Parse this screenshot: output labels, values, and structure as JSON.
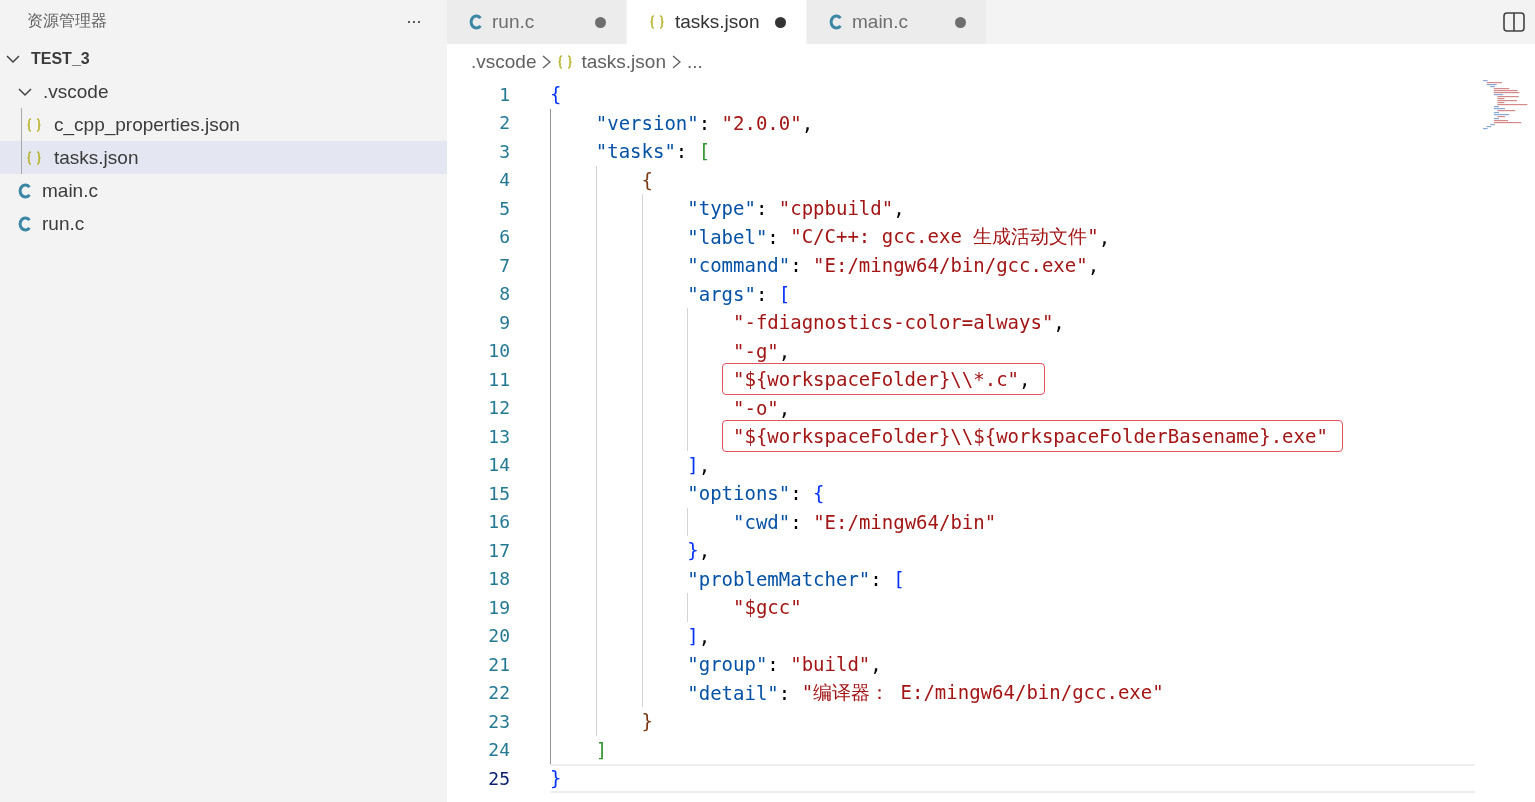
{
  "sidebar": {
    "title": "资源管理器",
    "more": "···",
    "tree": [
      {
        "label": "TEST_3",
        "kind": "root",
        "expanded": true,
        "selected": false,
        "children": [
          {
            "label": ".vscode",
            "kind": "folder",
            "expanded": true,
            "selected": false,
            "children": [
              {
                "label": "c_cpp_properties.json",
                "kind": "json",
                "selected": false
              },
              {
                "label": "tasks.json",
                "kind": "json",
                "selected": true
              }
            ]
          },
          {
            "label": "main.c",
            "kind": "c",
            "selected": false
          },
          {
            "label": "run.c",
            "kind": "c",
            "selected": false
          }
        ]
      }
    ]
  },
  "tabs": [
    {
      "label": "run.c",
      "kind": "c",
      "selected": false,
      "modified": true
    },
    {
      "label": "tasks.json",
      "kind": "json",
      "selected": true,
      "modified": true
    },
    {
      "label": "main.c",
      "kind": "c",
      "selected": false,
      "modified": true
    }
  ],
  "breadcrumb": [
    {
      "label": ".vscode",
      "kind": "folder"
    },
    {
      "label": "tasks.json",
      "kind": "json"
    },
    {
      "label": "...",
      "kind": "more"
    }
  ],
  "editor": {
    "lines": [
      {
        "number": "1",
        "boxed": false,
        "current": false,
        "tokens": [
          {
            "kind": "bracket1",
            "text": "{"
          }
        ]
      },
      {
        "number": "2",
        "boxed": false,
        "current": false,
        "tokens": [
          {
            "kind": "key",
            "text": "\"version\""
          },
          {
            "kind": "punct",
            "text": ": "
          },
          {
            "kind": "string",
            "text": "\"2.0.0\""
          },
          {
            "kind": "punct",
            "text": ","
          }
        ]
      },
      {
        "number": "3",
        "boxed": false,
        "current": false,
        "tokens": [
          {
            "kind": "key",
            "text": "\"tasks\""
          },
          {
            "kind": "punct",
            "text": ": "
          },
          {
            "kind": "bracket2",
            "text": "["
          }
        ]
      },
      {
        "number": "4",
        "boxed": false,
        "current": false,
        "tokens": [
          {
            "kind": "bracket3",
            "text": "{"
          }
        ]
      },
      {
        "number": "5",
        "boxed": false,
        "current": false,
        "tokens": [
          {
            "kind": "key",
            "text": "\"type\""
          },
          {
            "kind": "punct",
            "text": ": "
          },
          {
            "kind": "string",
            "text": "\"cppbuild\""
          },
          {
            "kind": "punct",
            "text": ","
          }
        ]
      },
      {
        "number": "6",
        "boxed": false,
        "current": false,
        "tokens": [
          {
            "kind": "key",
            "text": "\"label\""
          },
          {
            "kind": "punct",
            "text": ": "
          },
          {
            "kind": "string",
            "text": "\"C/C++: gcc.exe 生成活动文件\""
          },
          {
            "kind": "punct",
            "text": ","
          }
        ]
      },
      {
        "number": "7",
        "boxed": false,
        "current": false,
        "tokens": [
          {
            "kind": "key",
            "text": "\"command\""
          },
          {
            "kind": "punct",
            "text": ": "
          },
          {
            "kind": "string",
            "text": "\"E:/mingw64/bin/gcc.exe\""
          },
          {
            "kind": "punct",
            "text": ","
          }
        ]
      },
      {
        "number": "8",
        "boxed": false,
        "current": false,
        "tokens": [
          {
            "kind": "key",
            "text": "\"args\""
          },
          {
            "kind": "punct",
            "text": ": "
          },
          {
            "kind": "bracket1",
            "text": "["
          }
        ]
      },
      {
        "number": "9",
        "boxed": false,
        "current": false,
        "tokens": [
          {
            "kind": "string",
            "text": "\"-fdiagnostics-color=always\""
          },
          {
            "kind": "punct",
            "text": ","
          }
        ]
      },
      {
        "number": "10",
        "boxed": false,
        "current": false,
        "tokens": [
          {
            "kind": "string",
            "text": "\"-g\""
          },
          {
            "kind": "punct",
            "text": ","
          }
        ]
      },
      {
        "number": "11",
        "boxed": true,
        "current": false,
        "tokens": [
          {
            "kind": "string",
            "text": "\"${workspaceFolder}\\\\*.c\""
          },
          {
            "kind": "punct",
            "text": ","
          }
        ]
      },
      {
        "number": "12",
        "boxed": false,
        "current": false,
        "tokens": [
          {
            "kind": "string",
            "text": "\"-o\""
          },
          {
            "kind": "punct",
            "text": ","
          }
        ]
      },
      {
        "number": "13",
        "boxed": true,
        "current": false,
        "tokens": [
          {
            "kind": "string",
            "text": "\"${workspaceFolder}\\\\${workspaceFolderBasename}.exe\""
          }
        ]
      },
      {
        "number": "14",
        "boxed": false,
        "current": false,
        "tokens": [
          {
            "kind": "bracket1",
            "text": "]"
          },
          {
            "kind": "punct",
            "text": ","
          }
        ]
      },
      {
        "number": "15",
        "boxed": false,
        "current": false,
        "tokens": [
          {
            "kind": "key",
            "text": "\"options\""
          },
          {
            "kind": "punct",
            "text": ": "
          },
          {
            "kind": "bracket1",
            "text": "{"
          }
        ]
      },
      {
        "number": "16",
        "boxed": false,
        "current": false,
        "tokens": [
          {
            "kind": "key",
            "text": "\"cwd\""
          },
          {
            "kind": "punct",
            "text": ": "
          },
          {
            "kind": "string",
            "text": "\"E:/mingw64/bin\""
          }
        ]
      },
      {
        "number": "17",
        "boxed": false,
        "current": false,
        "tokens": [
          {
            "kind": "bracket1",
            "text": "}"
          },
          {
            "kind": "punct",
            "text": ","
          }
        ]
      },
      {
        "number": "18",
        "boxed": false,
        "current": false,
        "tokens": [
          {
            "kind": "key",
            "text": "\"problemMatcher\""
          },
          {
            "kind": "punct",
            "text": ": "
          },
          {
            "kind": "bracket1",
            "text": "["
          }
        ]
      },
      {
        "number": "19",
        "boxed": false,
        "current": false,
        "tokens": [
          {
            "kind": "string",
            "text": "\"$gcc\""
          }
        ]
      },
      {
        "number": "20",
        "boxed": false,
        "current": false,
        "tokens": [
          {
            "kind": "bracket1",
            "text": "]"
          },
          {
            "kind": "punct",
            "text": ","
          }
        ]
      },
      {
        "number": "21",
        "boxed": false,
        "current": false,
        "tokens": [
          {
            "kind": "key",
            "text": "\"group\""
          },
          {
            "kind": "punct",
            "text": ": "
          },
          {
            "kind": "string",
            "text": "\"build\""
          },
          {
            "kind": "punct",
            "text": ","
          }
        ]
      },
      {
        "number": "22",
        "boxed": false,
        "current": false,
        "tokens": [
          {
            "kind": "key",
            "text": "\"detail\""
          },
          {
            "kind": "punct",
            "text": ": "
          },
          {
            "kind": "string",
            "text": "\"编译器： E:/mingw64/bin/gcc.exe\""
          }
        ]
      },
      {
        "number": "23",
        "boxed": false,
        "current": false,
        "tokens": [
          {
            "kind": "bracket3",
            "text": "}"
          }
        ]
      },
      {
        "number": "24",
        "boxed": false,
        "current": false,
        "tokens": [
          {
            "kind": "bracket2",
            "text": "]"
          }
        ]
      },
      {
        "number": "25",
        "boxed": false,
        "current": true,
        "tokens": [
          {
            "kind": "bracket1",
            "text": "}"
          }
        ]
      }
    ]
  }
}
